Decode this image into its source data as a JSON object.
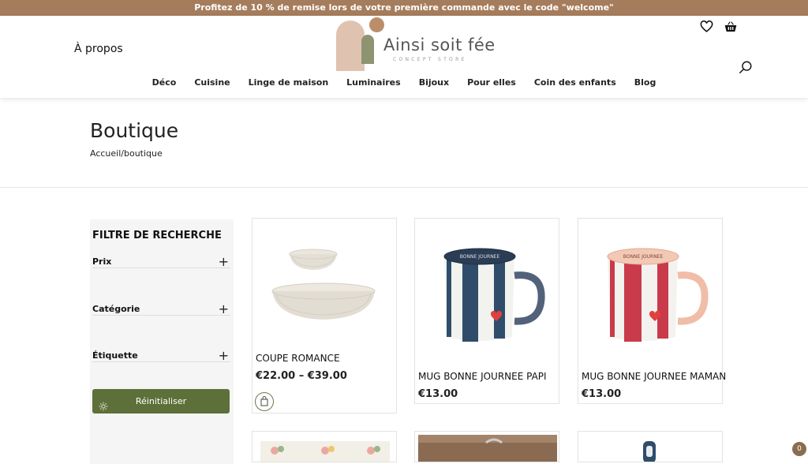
{
  "promo": {
    "text": "Profitez de 10 % de remise lors de votre première commande avec le code \"welcome\""
  },
  "header": {
    "about_link": "À propos",
    "logo": {
      "brand": "Ainsi soit fée",
      "tagline": "CONCEPT STORE"
    },
    "icons": [
      "heart-icon",
      "basket-icon",
      "search-icon"
    ]
  },
  "nav": {
    "items": [
      "Déco",
      "Cuisine",
      "Linge de maison",
      "Luminaires",
      "Bijoux",
      "Pour elles",
      "Coin des enfants",
      "Blog"
    ]
  },
  "page": {
    "title": "Boutique",
    "breadcrumb": "Accueil/boutique"
  },
  "sidebar": {
    "heading": "FILTRE DE RECHERCHE",
    "filters": [
      "Prix",
      "Catégorie",
      "Étiquette"
    ],
    "reset_label": "Réinitialiser"
  },
  "products": [
    {
      "name": "COUPE ROMANCE",
      "price": "€22.00 – €39.00"
    },
    {
      "name": "MUG BONNE JOURNEE PAPI",
      "price": "€13.00",
      "mug_text": "BONNE JOURNEE Papi",
      "stripe_color": "#2f4d6b",
      "handle_color": "#52627a"
    },
    {
      "name": "MUG BONNE JOURNEE MAMAN",
      "price": "€13.00",
      "mug_text": "BONNE JOURNEE Maman",
      "stripe_color": "#c93a4a",
      "handle_color": "#f0bda8"
    }
  ],
  "cart_bubble": {
    "count": "0"
  },
  "colors": {
    "promo_bg": "#a57c5c",
    "accent_green": "#5e7039",
    "heart": "#e0413b"
  }
}
